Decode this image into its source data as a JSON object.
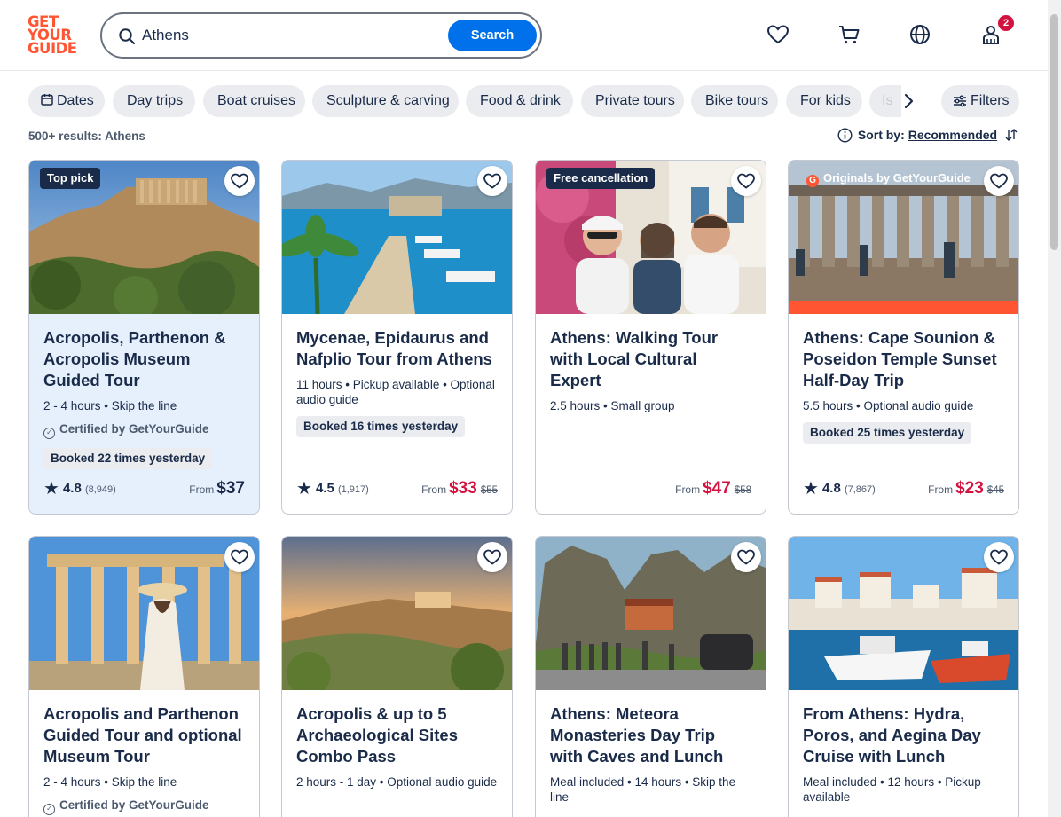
{
  "header": {
    "logo_lines": [
      "GET",
      "YOUR",
      "GUIDE"
    ],
    "search_value": "Athens",
    "search_button": "Search",
    "icons": [
      "heart-icon",
      "cart-icon",
      "globe-icon",
      "profile-icon"
    ],
    "notification_count": "2"
  },
  "chips": [
    "Dates",
    "Day trips",
    "Boat cruises",
    "Sculpture & carving",
    "Food & drink",
    "Private tours",
    "Bike tours",
    "For kids",
    "Is"
  ],
  "filters_label": "Filters",
  "results_text": "500+ results: Athens",
  "sort": {
    "label": "Sort by:",
    "value": "Recommended"
  },
  "colors": {
    "brand": "#ff5533",
    "primary": "#0071eb",
    "sale": "#d3123f",
    "highlight": "#e6f0fd"
  },
  "cards": [
    {
      "tag": "Top pick",
      "title": "Acropolis, Parthenon & Acropolis Museum Guided Tour",
      "meta": "2 - 4 hours • Skip the line",
      "certified": "Certified by GetYourGuide",
      "booked": "Booked 22 times yesterday",
      "rating": "4.8",
      "reviews": "(8,949)",
      "from": "From",
      "price": "$37",
      "old_price": ""
    },
    {
      "tag": "",
      "title": "Mycenae, Epidaurus and Nafplio Tour from Athens",
      "meta": "11 hours • Pickup available • Optional audio guide",
      "certified": "",
      "booked": "Booked 16 times yesterday",
      "rating": "4.5",
      "reviews": "(1,917)",
      "from": "From",
      "price": "$33",
      "old_price": "$55"
    },
    {
      "tag": "Free cancellation",
      "title": "Athens: Walking Tour with Local Cultural Expert",
      "meta": "2.5 hours • Small group",
      "certified": "",
      "booked": "",
      "rating": "",
      "reviews": "",
      "from": "From",
      "price": "$47",
      "old_price": "$58"
    },
    {
      "tag": "Originals by GetYourGuide",
      "title": "Athens: Cape Sounion & Poseidon Temple Sunset Half-Day Trip",
      "meta": "5.5 hours • Optional audio guide",
      "certified": "",
      "booked": "Booked 25 times yesterday",
      "rating": "4.8",
      "reviews": "(7,867)",
      "from": "From",
      "price": "$23",
      "old_price": "$45"
    },
    {
      "tag": "",
      "title": "Acropolis and Parthenon Guided Tour and optional Museum Tour",
      "meta": "2 - 4 hours • Skip the line",
      "certified": "Certified by GetYourGuide"
    },
    {
      "tag": "",
      "title": "Acropolis & up to 5 Archaeological Sites Combo Pass",
      "meta": "2 hours - 1 day • Optional audio guide"
    },
    {
      "tag": "",
      "title": "Athens: Meteora Monasteries Day Trip with Caves and Lunch",
      "meta": "Meal included • 14 hours • Skip the line"
    },
    {
      "tag": "",
      "title": "From Athens: Hydra, Poros, and Aegina Day Cruise with Lunch",
      "meta": "Meal included • 12 hours • Pickup available"
    }
  ]
}
